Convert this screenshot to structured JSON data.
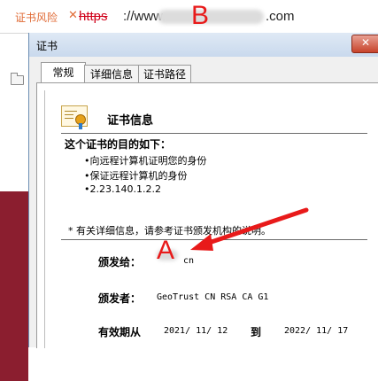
{
  "browser": {
    "warning_text": "证书风险",
    "warning_close": "✕",
    "url_scheme": "https",
    "url_prefix": "://www.",
    "url_suffix": ".com"
  },
  "annotations": {
    "label_b": "B",
    "label_a": "A"
  },
  "dialog": {
    "title": "证书",
    "close_glyph": "✕",
    "tabs": [
      "常规",
      "详细信息",
      "证书路径"
    ],
    "info_title": "证书信息",
    "purpose_heading": "这个证书的目的如下：",
    "purposes": [
      "•向远程计算机证明您的身份",
      "•保证远程计算机的身份",
      "•2.23.140.1.2.2"
    ],
    "note": "* 有关详细信息，请参考证书颁发机构的说明。",
    "issued_to_label": "颁发给：",
    "issued_to_value": "cn",
    "issued_by_label": "颁发者：",
    "issued_by_value": "GeoTrust CN RSA CA G1",
    "validity_label": "有效期从",
    "valid_from": "2021/ 11/ 12",
    "to_label": "到",
    "valid_to": "2022/ 11/ 17"
  },
  "colors": {
    "warning": "#e06b36",
    "annotation": "#e81a1a",
    "side_panel": "#8b1e2f"
  }
}
